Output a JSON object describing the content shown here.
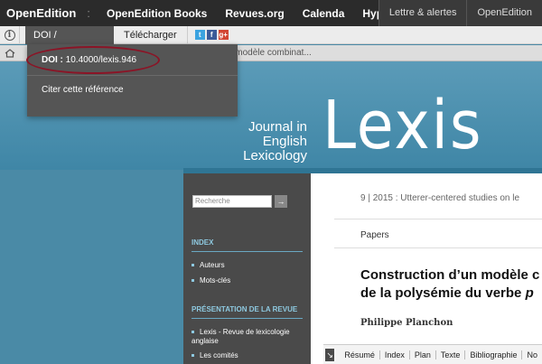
{
  "topnav": {
    "brand": "OpenEdition",
    "sep": ":",
    "links": [
      "OpenEdition Books",
      "Revues.org",
      "Calenda",
      "Hypothèses"
    ],
    "right": [
      "Lettre & alertes",
      "OpenEdition"
    ]
  },
  "toolbar": {
    "info": "i",
    "doi_tab": "DOI / Références",
    "download_tab": "Télécharger",
    "social": [
      "t",
      "f",
      "g+"
    ]
  },
  "breadcrumb": {
    "text": "Construction d'un modèle combinat..."
  },
  "dropdown": {
    "doi_label": "DOI :",
    "doi_value": "10.4000/lexis.946",
    "cite": "Citer cette référence"
  },
  "banner": {
    "journal_line1": "Journal in",
    "journal_line2": "English Lexicology",
    "logo": "Lexis"
  },
  "sidebar": {
    "search_placeholder": "Recherche",
    "search_button": "→",
    "index_heading": "INDEX",
    "index_items": [
      "Auteurs",
      "Mots-clés"
    ],
    "revue_heading": "PRÉSENTATION DE LA REVUE",
    "revue_items": [
      "Lexis - Revue de lexicologie anglaise",
      "Les comités"
    ]
  },
  "article": {
    "issue": "9 | 2015 : Utterer-centered studies on le",
    "section": "Papers",
    "title_line1": "Construction d’un modèle c",
    "title_line2": "de la polysémie du verbe ",
    "title_italic": "p",
    "author": "Philippe Planchon"
  },
  "tabs": {
    "arrow": "↘",
    "items": [
      "Résumé",
      "Index",
      "Plan",
      "Texte",
      "Bibliographie",
      "No"
    ]
  },
  "colors": {
    "topbar": "#2b2b2b",
    "banner": "#4a8aa6",
    "sidebar": "#4a4a4a",
    "highlight_ellipse": "#8b1426"
  }
}
